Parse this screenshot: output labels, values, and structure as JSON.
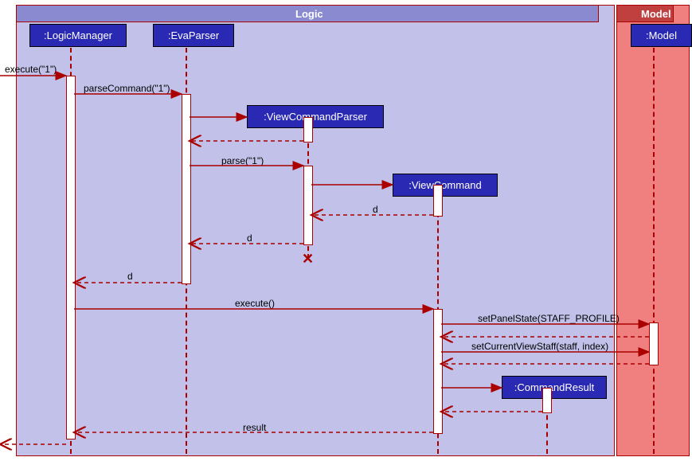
{
  "frames": {
    "logic": {
      "label": "Logic"
    },
    "model": {
      "label": "Model"
    }
  },
  "participants": {
    "logicManager": ":LogicManager",
    "evaParser": ":EvaParser",
    "viewCommandParser": ":ViewCommandParser",
    "viewCommand": ":ViewCommand",
    "commandResult": ":CommandResult",
    "model": ":Model"
  },
  "messages": {
    "execute1": "execute(\"1\")",
    "parseCommand1": "parseCommand(\"1\")",
    "parse1": "parse(\"1\")",
    "d1": "d",
    "d2": "d",
    "d3": "d",
    "execute": "execute()",
    "setPanelState": "setPanelState(STAFF_PROFILE)",
    "setCurrentViewStaff": "setCurrentViewStaff(staff, index)",
    "result": "result"
  },
  "chart_data": {
    "type": "sequence-diagram",
    "title": "",
    "frames": [
      {
        "name": "Logic",
        "contains": [
          "LogicManager",
          "EvaParser",
          "ViewCommandParser",
          "ViewCommand",
          "CommandResult"
        ]
      },
      {
        "name": "Model",
        "contains": [
          "Model"
        ]
      }
    ],
    "participants": [
      "LogicManager",
      "EvaParser",
      "ViewCommandParser",
      "ViewCommand",
      "CommandResult",
      "Model"
    ],
    "messages": [
      {
        "from": "external",
        "to": "LogicManager",
        "label": "execute(\"1\")",
        "type": "sync"
      },
      {
        "from": "LogicManager",
        "to": "EvaParser",
        "label": "parseCommand(\"1\")",
        "type": "sync"
      },
      {
        "from": "EvaParser",
        "to": "ViewCommandParser",
        "label": "",
        "type": "create"
      },
      {
        "from": "ViewCommandParser",
        "to": "EvaParser",
        "label": "",
        "type": "return"
      },
      {
        "from": "EvaParser",
        "to": "ViewCommandParser",
        "label": "parse(\"1\")",
        "type": "sync"
      },
      {
        "from": "ViewCommandParser",
        "to": "ViewCommand",
        "label": "",
        "type": "create"
      },
      {
        "from": "ViewCommand",
        "to": "ViewCommandParser",
        "label": "d",
        "type": "return"
      },
      {
        "from": "ViewCommandParser",
        "to": "EvaParser",
        "label": "d",
        "type": "return"
      },
      {
        "from": "ViewCommandParser",
        "to": "",
        "label": "",
        "type": "destroy"
      },
      {
        "from": "EvaParser",
        "to": "LogicManager",
        "label": "d",
        "type": "return"
      },
      {
        "from": "LogicManager",
        "to": "ViewCommand",
        "label": "execute()",
        "type": "sync"
      },
      {
        "from": "ViewCommand",
        "to": "Model",
        "label": "setPanelState(STAFF_PROFILE)",
        "type": "sync"
      },
      {
        "from": "Model",
        "to": "ViewCommand",
        "label": "",
        "type": "return"
      },
      {
        "from": "ViewCommand",
        "to": "Model",
        "label": "setCurrentViewStaff(staff, index)",
        "type": "sync"
      },
      {
        "from": "Model",
        "to": "ViewCommand",
        "label": "",
        "type": "return"
      },
      {
        "from": "ViewCommand",
        "to": "CommandResult",
        "label": "",
        "type": "create"
      },
      {
        "from": "CommandResult",
        "to": "ViewCommand",
        "label": "",
        "type": "return"
      },
      {
        "from": "ViewCommand",
        "to": "LogicManager",
        "label": "result",
        "type": "return"
      },
      {
        "from": "LogicManager",
        "to": "external",
        "label": "",
        "type": "return"
      }
    ]
  }
}
